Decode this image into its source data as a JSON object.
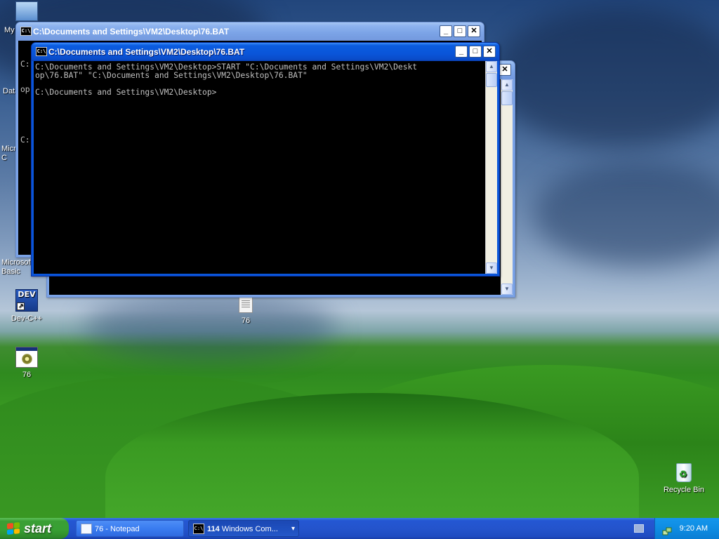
{
  "desktop": {
    "icons": [
      {
        "label": "My"
      },
      {
        "label": "Data"
      },
      {
        "label": "Micro C"
      },
      {
        "label": "Microsoft Basic"
      },
      {
        "label": "Dev-C++"
      },
      {
        "label": "76"
      },
      {
        "label": "76"
      },
      {
        "label": "Recycle Bin"
      }
    ]
  },
  "windows": {
    "back": {
      "title": "C:\\Documents and Settings\\VM2\\Desktop\\76.BAT",
      "console_lines": [
        "C:",
        "op",
        "",
        "C:"
      ]
    },
    "front": {
      "title": "C:\\Documents and Settings\\VM2\\Desktop\\76.BAT",
      "console_text": "C:\\Documents and Settings\\VM2\\Desktop>START \"C:\\Documents and Settings\\VM2\\Deskt\nop\\76.BAT\" \"C:\\Documents and Settings\\VM2\\Desktop\\76.BAT\"\n\nC:\\Documents and Settings\\VM2\\Desktop>"
    },
    "minimize_glyph": "_",
    "maximize_glyph": "□",
    "close_glyph": "✕",
    "scroll_up_glyph": "▲",
    "scroll_down_glyph": "▼",
    "icon_text": "C:\\"
  },
  "taskbar": {
    "start_label": "start",
    "buttons": [
      {
        "label": "76 - Notepad",
        "icon": "notepad-icon"
      },
      {
        "count": "114",
        "label": "Windows Com...",
        "icon": "console-icon"
      }
    ],
    "dropdown_glyph": "▾",
    "clock": "9:20 AM"
  },
  "colors": {
    "title_active": "#0a55d9",
    "taskbar": "#2454cc",
    "start": "#38a033",
    "tray": "#0e8ce2",
    "console_bg": "#000000",
    "console_fg": "#c0c0c0"
  }
}
